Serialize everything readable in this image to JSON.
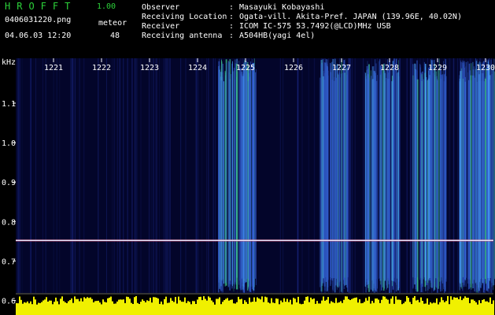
{
  "app": {
    "title": "HROFFT",
    "version": "1.00"
  },
  "file": {
    "name": "0406031220.png",
    "datetime": "04.06.03 12:20"
  },
  "meteor": {
    "label": "meteor",
    "count": "48"
  },
  "info": [
    {
      "label": "Observer",
      "value": "Masayuki Kobayashi"
    },
    {
      "label": "Receiving Location",
      "value": "Ogata-vill. Akita-Pref. JAPAN (139.96E, 40.02N)"
    },
    {
      "label": "Receiver",
      "value": "ICOM IC-575 53.7492(@LCD)MHz USB"
    },
    {
      "label": "Receiving antenna",
      "value": "A504HB(yagi 4el)"
    }
  ],
  "colors": {
    "background": "#000000",
    "title": "#2cd23a",
    "text": "#ffffff",
    "signal_line": "#e6e6ff",
    "amplitude": "#f0f000",
    "noise": "#1c2a8c"
  },
  "spectrogram": {
    "y_unit": "kHz",
    "y_ticks": [
      "1.1",
      "1.0",
      "0.9",
      "0.8",
      "0.7",
      "0.6"
    ],
    "time_ticks": [
      "1221",
      "1222",
      "1223",
      "1224",
      "1225",
      "1226",
      "1227",
      "1228",
      "1229",
      "1230"
    ],
    "carrier_khz": 0.752,
    "bursts": [
      {
        "time_label": "1225",
        "intensity": 0.95
      },
      {
        "time_label": "1227",
        "intensity": 0.55
      },
      {
        "time_label": "1228",
        "intensity": 0.8
      },
      {
        "time_label": "1229",
        "intensity": 0.75
      },
      {
        "time_label": "1230",
        "intensity": 0.9
      }
    ]
  }
}
